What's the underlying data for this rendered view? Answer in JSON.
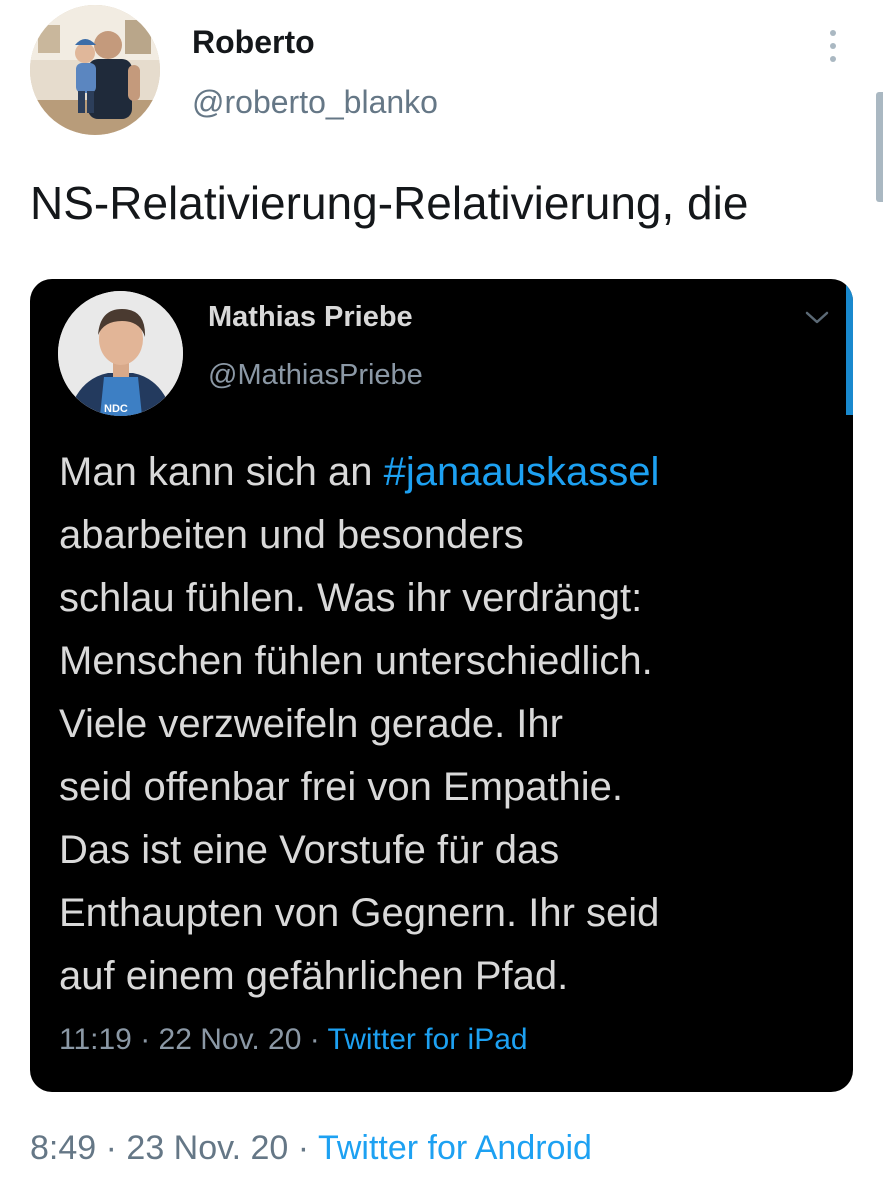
{
  "outer_tweet": {
    "author_name": "Roberto",
    "author_handle": "@roberto_blanko",
    "text": "NS-Relativierung-Relativierung, die",
    "time": "8:49",
    "separator": " · ",
    "date": "23 Nov. 20",
    "source": "Twitter for Android",
    "more_icon": "more-vertical-icon"
  },
  "quoted_tweet": {
    "author_name": "Mathias Priebe",
    "author_handle": "@MathiasPriebe",
    "text_lines": [
      {
        "pre": "Man kann sich an ",
        "hashtag": "#janaauskassel"
      },
      {
        "pre": "abarbeiten und besonders"
      },
      {
        "pre": "schlau fühlen. Was ihr verdrängt:"
      },
      {
        "pre": "Menschen fühlen unterschiedlich."
      },
      {
        "pre": "Viele verzweifeln gerade. Ihr"
      },
      {
        "pre": "seid offenbar frei von Empathie."
      },
      {
        "pre": "Das ist eine Vorstufe für das"
      },
      {
        "pre": "Enthaupten von Gegnern. Ihr seid"
      },
      {
        "pre": "auf einem gefährlichen Pfad."
      }
    ],
    "time": "11:19",
    "separator": " · ",
    "date": "22 Nov. 20",
    "source": "Twitter for iPad",
    "chevron_icon": "chevron-down-icon",
    "avatar_shirt_text": "NDC"
  },
  "colors": {
    "link_blue": "#1da1f2",
    "dark_card": "#000000",
    "muted_gray": "#657786"
  }
}
